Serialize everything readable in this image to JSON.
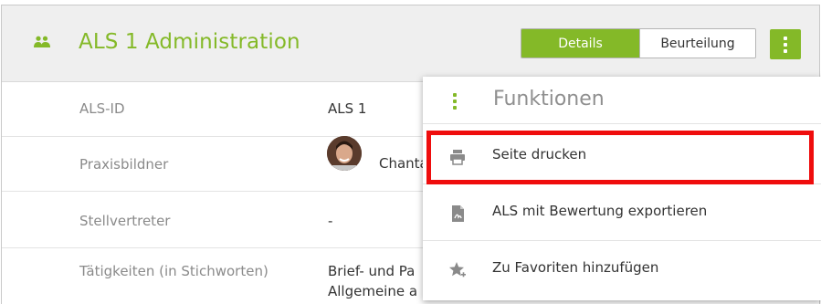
{
  "header": {
    "title": "ALS 1 Administration",
    "icon": "users-icon",
    "tabs": [
      {
        "label": "Details",
        "active": true
      },
      {
        "label": "Beurteilung",
        "active": false
      }
    ],
    "menu_icon": "vertical-dots-icon"
  },
  "rows": [
    {
      "label": "ALS-ID",
      "value": "ALS 1"
    },
    {
      "label": "Praxisbildner",
      "value": "Chanta"
    },
    {
      "label": "Stellvertreter",
      "value": "-"
    },
    {
      "label": "Tätigkeiten (in Stichworten)",
      "value_line1": "Brief- und Pa",
      "value_line2": "Allgemeine a"
    }
  ],
  "dropdown": {
    "title": "Funktionen",
    "items": [
      {
        "label": "Seite drucken",
        "icon": "printer-icon"
      },
      {
        "label": "ALS mit Bewertung exportieren",
        "icon": "pdf-document-icon"
      },
      {
        "label": "Zu Favoriten hinzufügen",
        "icon": "star-add-icon"
      }
    ]
  },
  "colors": {
    "accent": "#84b928",
    "highlight": "#ef0d0d"
  }
}
